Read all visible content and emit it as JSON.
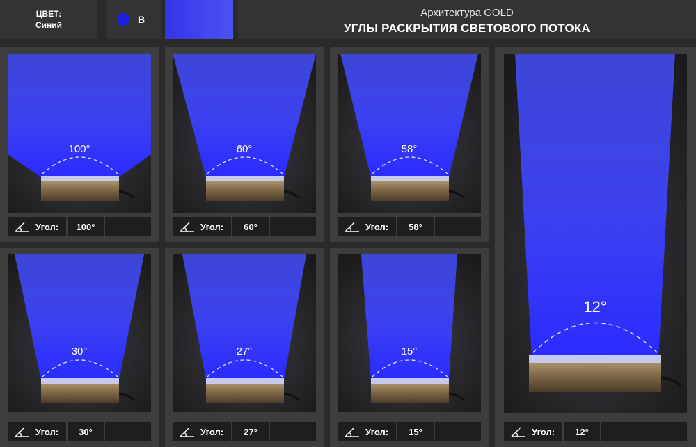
{
  "header": {
    "color_label": "ЦВЕТ:",
    "color_value": "Синий",
    "color_code": "B",
    "brand": "Архитектура GOLD",
    "title": "УГЛЫ РАСКРЫТИЯ СВЕТОВОГО ПОТОКА",
    "swatch_color": "#3a3ff0"
  },
  "angle_label": "Угол:",
  "cards": [
    {
      "angle": "100°"
    },
    {
      "angle": "60°"
    },
    {
      "angle": "58°"
    },
    {
      "angle": "30°"
    },
    {
      "angle": "27°"
    },
    {
      "angle": "15°"
    },
    {
      "angle": "12°"
    }
  ]
}
